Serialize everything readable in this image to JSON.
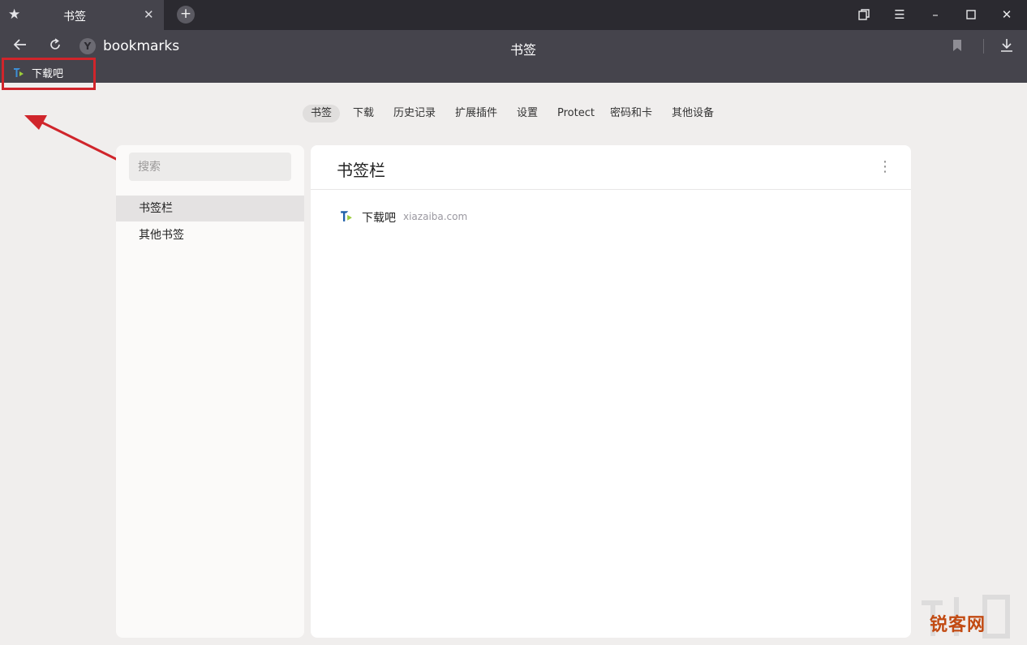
{
  "tab": {
    "title": "书签",
    "close_symbol": "✕",
    "new_tab_symbol": "+"
  },
  "toolbar": {
    "address": "bookmarks",
    "page_title": "书签",
    "browser_logo_letter": "Y"
  },
  "bookmarks_bar": {
    "items": [
      {
        "label": "下载吧"
      }
    ]
  },
  "nav_tabs": [
    {
      "label": "书签",
      "active": true
    },
    {
      "label": "下载"
    },
    {
      "label": "历史记录"
    },
    {
      "label": "扩展插件"
    },
    {
      "label": "设置"
    },
    {
      "label": "Protect"
    },
    {
      "label": "密码和卡"
    },
    {
      "label": "其他设备"
    }
  ],
  "sidebar": {
    "search_placeholder": "搜索",
    "folders": [
      {
        "label": "书签栏",
        "active": true
      },
      {
        "label": "其他书签"
      }
    ]
  },
  "main": {
    "title": "书签栏",
    "bookmarks": [
      {
        "title": "下载吧",
        "url": "xiazaiba.com"
      }
    ]
  },
  "watermark": {
    "text": "锐客网"
  },
  "annotation": {
    "highlight_color": "#d0252b",
    "arrow_color": "#d0252b"
  }
}
